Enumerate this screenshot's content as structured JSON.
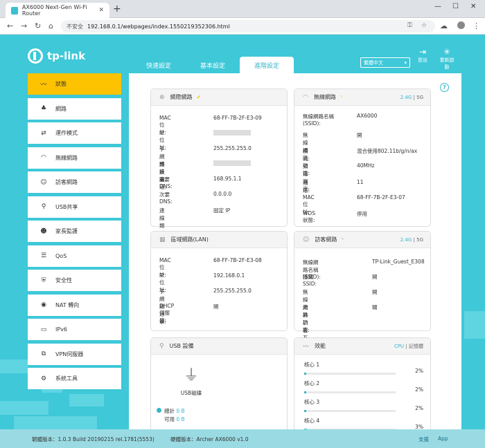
{
  "browser": {
    "tab_title": "AX6000 Next-Gen Wi-Fi Router",
    "security_label": "不安全",
    "url": "192.168.0.1/webpages/index.1550219352306.html"
  },
  "header": {
    "brand": "tp-link",
    "tabs": [
      {
        "label": "快速設定"
      },
      {
        "label": "基本設定"
      },
      {
        "label": "進階設定"
      }
    ],
    "language": "繁體中文",
    "logout_label": "登出",
    "reboot_label": "重新啟動"
  },
  "sidebar": {
    "items": [
      {
        "label": "狀態",
        "icon": "pulse-icon"
      },
      {
        "label": "網路",
        "icon": "network-icon"
      },
      {
        "label": "運作模式",
        "icon": "mode-icon"
      },
      {
        "label": "無線網路",
        "icon": "wifi-icon"
      },
      {
        "label": "訪客網路",
        "icon": "guest-icon"
      },
      {
        "label": "USB共享",
        "icon": "usb-icon"
      },
      {
        "label": "家長監護",
        "icon": "parent-icon"
      },
      {
        "label": "QoS",
        "icon": "qos-icon"
      },
      {
        "label": "安全性",
        "icon": "shield-icon"
      },
      {
        "label": "NAT 轉向",
        "icon": "nat-icon"
      },
      {
        "label": "IPv6",
        "icon": "ipv6-icon"
      },
      {
        "label": "VPN伺服器",
        "icon": "vpn-icon"
      },
      {
        "label": "系統工具",
        "icon": "gear-icon"
      }
    ]
  },
  "internet": {
    "title": "網際網路",
    "rows": [
      {
        "k": "MAC 位址:",
        "v": "68-FF-7B-2F-E3-09"
      },
      {
        "k": "IP 位址:",
        "v": ""
      },
      {
        "k": "子網路遮罩:",
        "v": "255.255.255.0"
      },
      {
        "k": "預設閘道:",
        "v": ""
      },
      {
        "k": "主要 DNS:",
        "v": "168.95.1.1"
      },
      {
        "k": "次要 DNS:",
        "v": "0.0.0.0"
      },
      {
        "k": "連線類型:",
        "v": "固定 IP"
      }
    ]
  },
  "wireless": {
    "title": "無線網路",
    "band_a": "2.4G",
    "band_sep": "|",
    "band_b": "5G",
    "rows": [
      {
        "k": "無線網路名稱 (SSID):",
        "v": "AX6000"
      },
      {
        "k": "無線網路功能:",
        "v": "開"
      },
      {
        "k": "模式:",
        "v": "混合使用802.11b/g/n/ax"
      },
      {
        "k": "頻道寬度:",
        "v": "40MHz"
      },
      {
        "k": "頻道:",
        "v": "11"
      },
      {
        "k": "MAC 位址:",
        "v": "68-FF-7B-2F-E3-07"
      },
      {
        "k": "WDS 狀態:",
        "v": "停用"
      }
    ]
  },
  "lan": {
    "title": "區域網路(LAN)",
    "rows": [
      {
        "k": "MAC 位址:",
        "v": "68-FF-7B-2F-E3-08"
      },
      {
        "k": "IP 位址:",
        "v": "192.168.0.1"
      },
      {
        "k": "子網路遮罩:",
        "v": "255.255.255.0"
      },
      {
        "k": "DHCP 伺服器:",
        "v": "開"
      }
    ]
  },
  "guest": {
    "title": "訪客網路",
    "band_a": "2.4G",
    "band_sep": "|",
    "band_b": "5G",
    "rows": [
      {
        "k": "無線網路名稱 (SSID):",
        "v": "TP-Link_Guest_E308"
      },
      {
        "k": "隱藏 SSID:",
        "v": "開"
      },
      {
        "k": "無線網路功能:",
        "v": "開"
      },
      {
        "k": "允許訪客互相存取:",
        "v": "關"
      }
    ]
  },
  "usb": {
    "title": "USB 設備",
    "disk_label": "USB磁碟",
    "total_label": "總計",
    "total_value": "0 B",
    "avail_label": "可用",
    "avail_value": "0 B"
  },
  "performance": {
    "title": "效能",
    "mode_a": "CPU",
    "mode_sep": "|",
    "mode_b": "記憶體",
    "cores": [
      {
        "label": "核心 1",
        "pct_text": "2%",
        "pct": 0.02
      },
      {
        "label": "核心 2",
        "pct_text": "2%",
        "pct": 0.02
      },
      {
        "label": "核心 3",
        "pct_text": "2%",
        "pct": 0.02
      },
      {
        "label": "核心 4",
        "pct_text": "3%",
        "pct": 0.03
      }
    ]
  },
  "footer": {
    "firmware": "韌體版本：1.0.3 Build 20190215 rel.1781(5553)",
    "hardware": "硬體版本：Archer AX6000 v1.0",
    "support": "支援",
    "app": "App"
  }
}
